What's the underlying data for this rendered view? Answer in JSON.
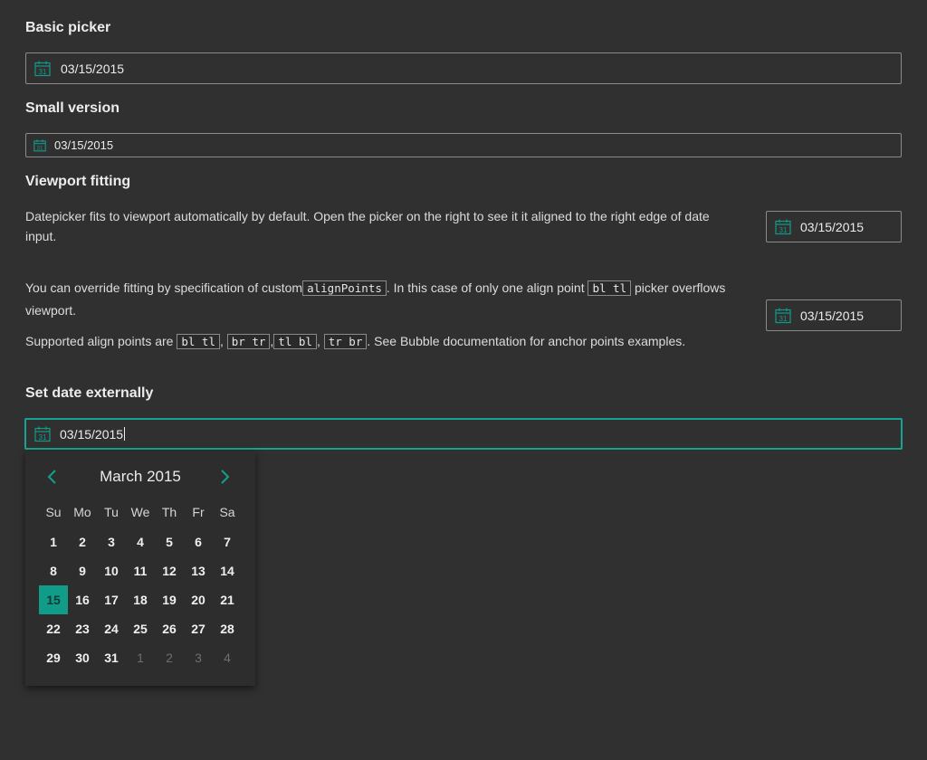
{
  "sections": {
    "basic": {
      "title": "Basic picker",
      "value": "03/15/2015"
    },
    "small": {
      "title": "Small version",
      "value": "03/15/2015"
    },
    "viewport": {
      "title": "Viewport fitting",
      "p1": "Datepicker fits to viewport automatically by default. Open the picker on the right to see it it aligned to the right edge of date input.",
      "value1": "03/15/2015",
      "p2_before": "You can override fitting by specification of custom",
      "p2_code1": "alignPoints",
      "p2_mid": ". In this case of only one align point ",
      "p2_code2": "bl tl",
      "p2_after": " picker overflows viewport.",
      "value2": "03/15/2015",
      "p3_before": "Supported align points are ",
      "p3_codes": [
        "bl tl",
        "br tr",
        "tl bl",
        "tr br"
      ],
      "p3_after": ". See Bubble documentation for anchor points examples."
    },
    "external": {
      "title": "Set date externally",
      "value": "03/15/2015"
    }
  },
  "calendar": {
    "month_label": "March 2015",
    "weekdays": [
      "Su",
      "Mo",
      "Tu",
      "We",
      "Th",
      "Fr",
      "Sa"
    ],
    "weeks": [
      [
        "1",
        "2",
        "3",
        "4",
        "5",
        "6",
        "7"
      ],
      [
        "8",
        "9",
        "10",
        "11",
        "12",
        "13",
        "14"
      ],
      [
        "15",
        "16",
        "17",
        "18",
        "19",
        "20",
        "21"
      ],
      [
        "22",
        "23",
        "24",
        "25",
        "26",
        "27",
        "28"
      ],
      [
        "29",
        "30",
        "31",
        "1",
        "2",
        "3",
        "4"
      ]
    ],
    "selected_day": "15",
    "accent": "#119c8a"
  },
  "icons": {
    "calendar": "calendar-icon",
    "prev": "chevron-left-icon",
    "next": "chevron-right-icon"
  }
}
